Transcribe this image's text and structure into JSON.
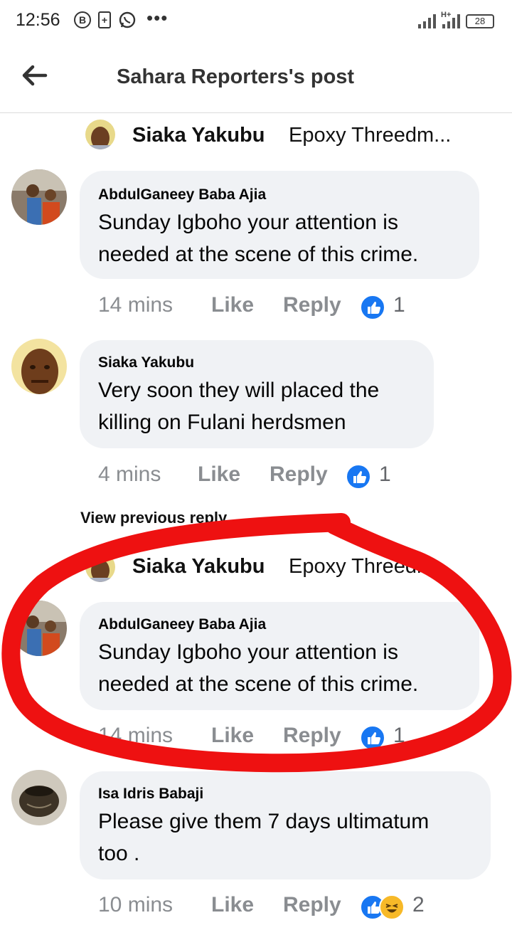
{
  "status_bar": {
    "time": "12:56",
    "battery": "28",
    "icons": [
      "b-app-icon",
      "battery-saver-icon",
      "whatsapp-icon",
      "more-dots-icon",
      "signal-icon",
      "network-signal-icon"
    ]
  },
  "header": {
    "title": "Sahara Reporters's post"
  },
  "thread1": {
    "reply_to_name": "Siaka Yakubu",
    "reply_to_text": "Epoxy Threedm..."
  },
  "comments1": [
    {
      "author": "AbdulGaneey Baba Ajia",
      "line1": "Sunday Igboho your attention is",
      "line2": "needed at the scene of this crime.",
      "time": "14 mins",
      "like": "Like",
      "reply": "Reply",
      "count": "1"
    },
    {
      "author": "Siaka Yakubu",
      "line1": "Very soon they will placed the",
      "line2": "killing on Fulani herdsmen",
      "time": "4 mins",
      "like": "Like",
      "reply": "Reply",
      "count": "1"
    }
  ],
  "view_previous": "View previous reply",
  "thread2": {
    "reply_to_name": "Siaka Yakubu",
    "reply_to_text": "Epoxy Threedm..."
  },
  "comments2": [
    {
      "author": "AbdulGaneey Baba Ajia",
      "line1": "Sunday Igboho your attention is",
      "line2": "needed at the scene of this crime.",
      "time": "14 mins",
      "like": "Like",
      "reply": "Reply",
      "count": "1"
    },
    {
      "author": "Isa Idris Babaji",
      "line1": "Please give them 7 days ultimatum",
      "line2": "too .",
      "time": "10 mins",
      "like": "Like",
      "reply": "Reply",
      "count": "2"
    }
  ],
  "colors": {
    "accent": "#1877f2",
    "annotation": "#ee1111",
    "bubble": "#f0f2f5",
    "meta": "#8a8d91"
  }
}
